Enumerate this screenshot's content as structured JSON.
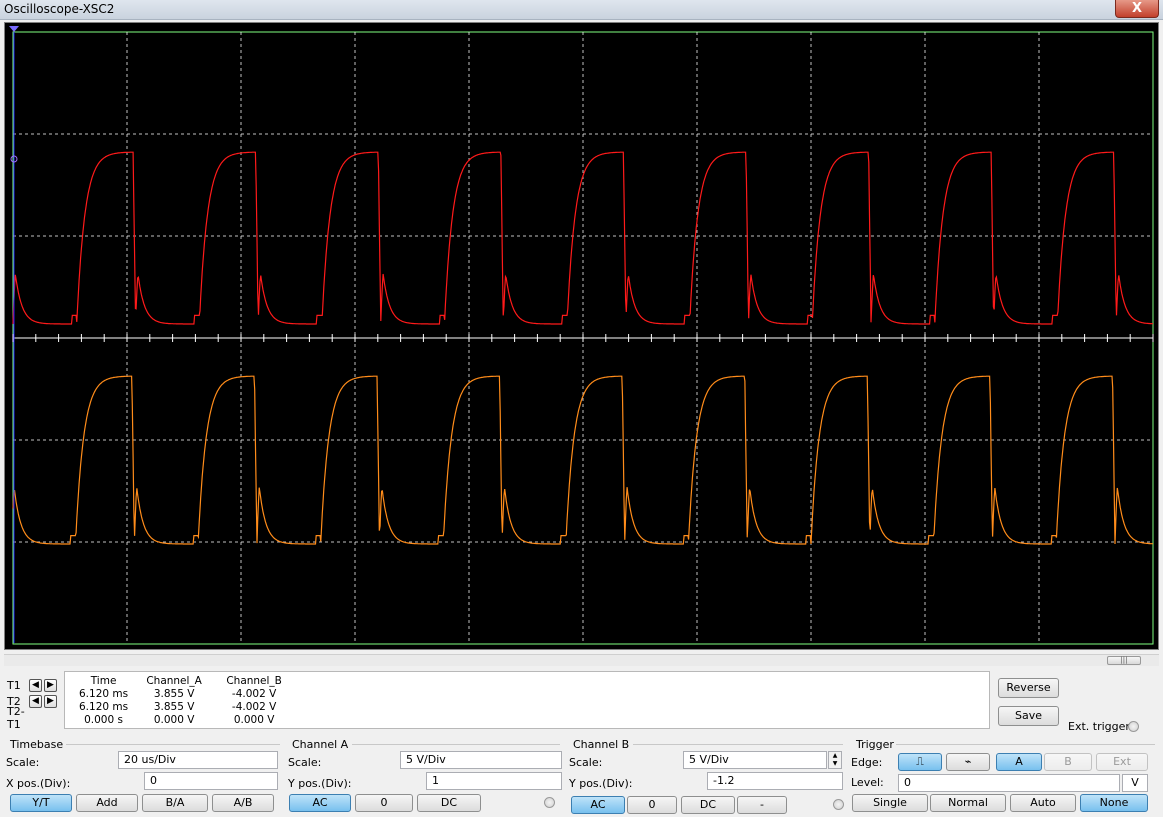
{
  "window": {
    "title": "Oscilloscope-XSC2",
    "close_label": "X"
  },
  "colors": {
    "screen_bg": "#000000",
    "grid": "#ffffff",
    "channel_a": "#ff1a1a",
    "channel_b": "#ff8c1a",
    "border": "#7fff7f",
    "active_button": "#78c0ee"
  },
  "cursors": {
    "t1_label": "T1",
    "t2_label": "T2",
    "delta_label": "T2-T1"
  },
  "readout": {
    "headers": [
      "Time",
      "Channel_A",
      "Channel_B"
    ],
    "rows": [
      [
        "6.120 ms",
        "3.855 V",
        "-4.002 V"
      ],
      [
        "6.120 ms",
        "3.855 V",
        "-4.002 V"
      ],
      [
        "0.000 s",
        "0.000 V",
        "0.000 V"
      ]
    ]
  },
  "side_buttons": {
    "reverse": "Reverse",
    "save": "Save",
    "ext_trigger": "Ext. trigger"
  },
  "timebase": {
    "title": "Timebase",
    "scale_label": "Scale:",
    "scale_value": "20 us/Div",
    "xpos_label": "X pos.(Div):",
    "xpos_value": "0",
    "buttons": [
      "Y/T",
      "Add",
      "B/A",
      "A/B"
    ],
    "active": "Y/T"
  },
  "channel_a": {
    "title": "Channel A",
    "scale_label": "Scale:",
    "scale_value": "5  V/Div",
    "ypos_label": "Y pos.(Div):",
    "ypos_value": "1",
    "buttons": [
      "AC",
      "0",
      "DC"
    ],
    "active": "AC"
  },
  "channel_b": {
    "title": "Channel B",
    "scale_label": "Scale:",
    "scale_value": "5  V/Div",
    "ypos_label": "Y pos.(Div):",
    "ypos_value": "-1.2",
    "buttons": [
      "AC",
      "0",
      "DC",
      "-"
    ],
    "active": "AC"
  },
  "trigger": {
    "title": "Trigger",
    "edge_label": "Edge:",
    "level_label": "Level:",
    "level_value": "0",
    "level_unit": "V",
    "source_buttons": [
      "A",
      "B",
      "Ext"
    ],
    "active_source": "A",
    "mode_buttons": [
      "Single",
      "Normal",
      "Auto",
      "None"
    ],
    "active_mode": "None"
  },
  "waveform": {
    "periods_visible": 9.3,
    "channel_a_ypos_div": 1,
    "channel_b_ypos_div": -1.2,
    "volts_per_div": 5
  }
}
